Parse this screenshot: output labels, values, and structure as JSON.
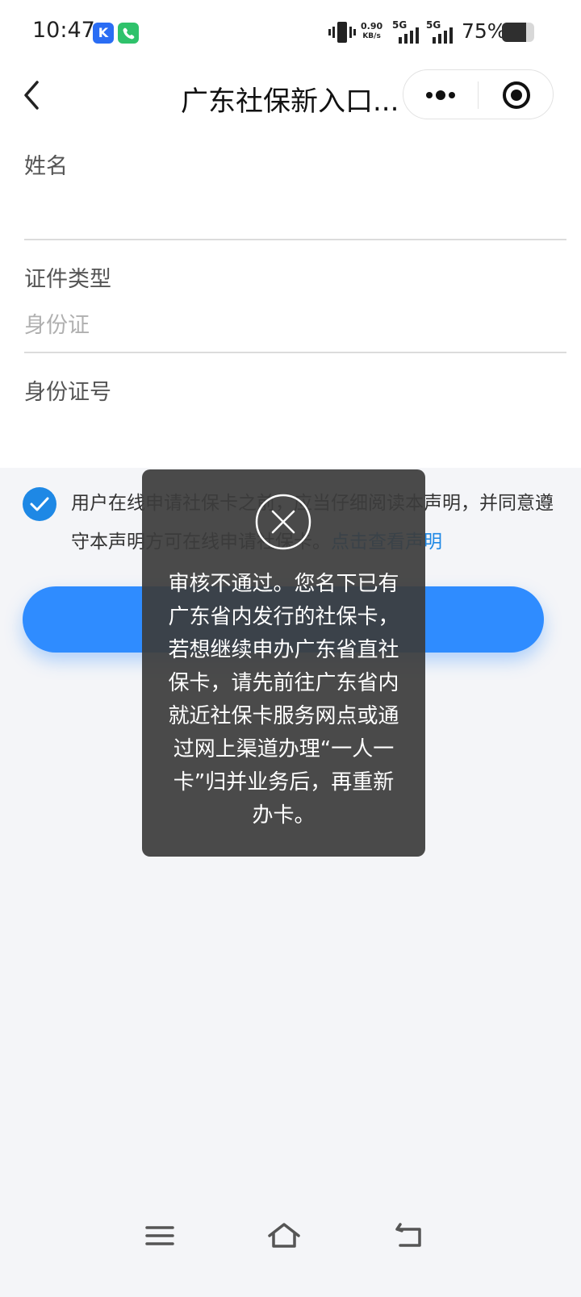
{
  "status_bar": {
    "time": "10:47",
    "app_icons": [
      "k-app-icon",
      "phone-app-icon"
    ],
    "badge_k": "K",
    "net_speed_value": "0.90",
    "net_speed_unit": "KB/s",
    "network_1": "5G",
    "network_2": "5G",
    "battery_percent": "75%",
    "battery_level": 0.75
  },
  "nav": {
    "title": "广东社保新入口...",
    "back_icon": "chevron-left-icon",
    "more_icon": "more-dots-icon",
    "close_icon": "target-circle-icon"
  },
  "form": {
    "name_label": "姓名",
    "name_value": "",
    "id_type_label": "证件类型",
    "id_type_value": "身份证",
    "id_number_label": "身份证号",
    "id_number_value": ""
  },
  "agreement": {
    "checked": true,
    "text": "用户在线申请社保卡之前，应当仔细阅读本声明，并同意遵守本声明方可在线申请社保卡。",
    "link_text": "点击查看声明"
  },
  "toast": {
    "icon": "close-circle-icon",
    "message": "审核不通过。您名下已有广东省内发行的社保卡，若想继续申办广东省直社保卡，请先前往广东省内就近社保卡服务网点或通过网上渠道办理“一人一卡”归并业务后，再重新办卡。"
  },
  "colors": {
    "accent": "#2f8cff",
    "link": "#1e88e5",
    "toast_bg": "#3c3c3c"
  },
  "system_nav": [
    "menu-icon",
    "home-icon",
    "back-icon"
  ]
}
